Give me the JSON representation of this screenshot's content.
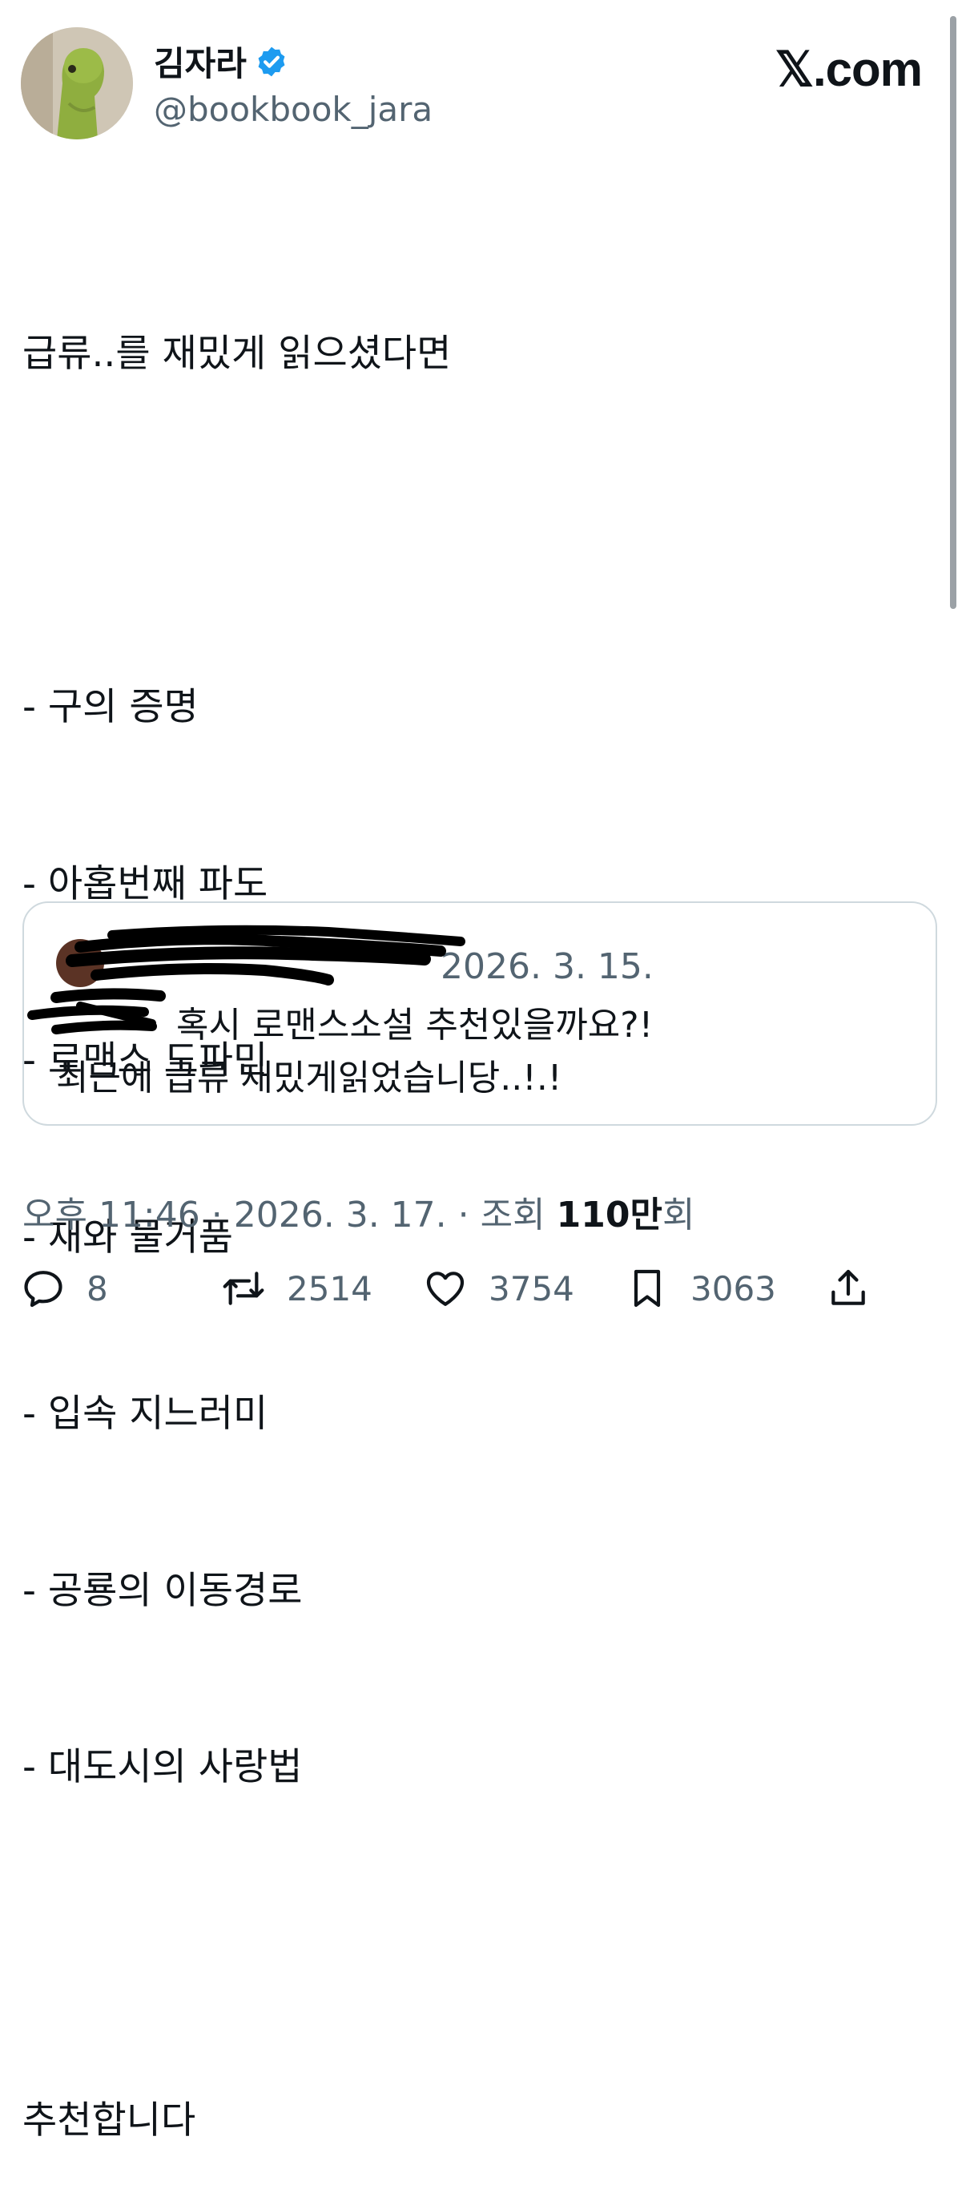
{
  "author": {
    "name": "김자라",
    "handle": "@bookbook_jara",
    "verified": true
  },
  "brand": "𝕏.com",
  "tweet": {
    "lines": [
      "급류..를 재밌게 읽으셨다면",
      "",
      "- 구의 증명",
      "- 아홉번째 파도",
      "- 로맨스 도파민",
      "- 재와 물거품",
      "- 입속 지느러미",
      "- 공룡의 이동경로",
      "- 대도시의 사랑법",
      "",
      "추천합니다"
    ]
  },
  "quote": {
    "date": "2026. 3. 15.",
    "line1": "혹시 로맨스소설 추천있을까요?!",
    "line2": "최근에 급류 재밌게읽었습니당..!.!"
  },
  "meta": {
    "time": "오후 11:46",
    "date": "2026. 3. 17.",
    "views_prefix": "조회",
    "views_count": "110만",
    "views_suffix": "회",
    "separator": "·"
  },
  "actions": {
    "replies": "8",
    "retweets": "2514",
    "likes": "3754",
    "bookmarks": "3063"
  },
  "icons": {
    "reply": "reply-icon",
    "retweet": "retweet-icon",
    "like": "heart-icon",
    "bookmark": "bookmark-icon",
    "share": "share-icon",
    "verified": "verified-badge-icon"
  },
  "colors": {
    "verified": "#1d9bf0",
    "secondary_text": "#536471",
    "primary_text": "#0f1419",
    "border": "#cfd9de"
  }
}
